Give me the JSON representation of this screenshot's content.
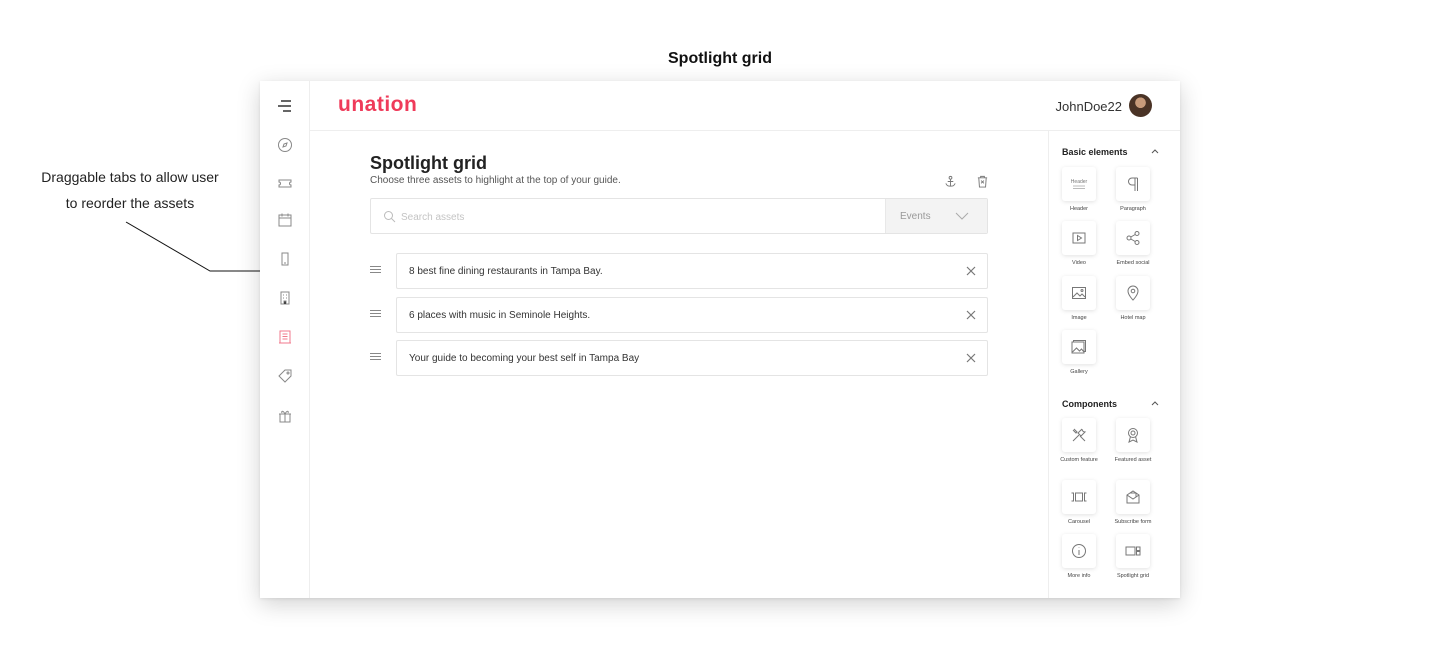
{
  "page_caption": "Spotlight grid",
  "annotation": {
    "line1": "Draggable tabs to allow user",
    "line2": "to reorder the assets"
  },
  "header": {
    "logo": "unation",
    "username": "JohnDoe22"
  },
  "nav": {
    "items": [
      "menu-icon",
      "compass-icon",
      "ticket-icon",
      "calendar-icon",
      "phone-icon",
      "building-icon",
      "guide-icon",
      "tag-icon",
      "gift-icon"
    ],
    "active": "guide-icon"
  },
  "main": {
    "title": "Spotlight grid",
    "subtitle": "Choose three assets to highlight at the top of your guide.",
    "search_placeholder": "Search assets",
    "filter_label": "Events",
    "assets": [
      "8 best fine dining restaurants in Tampa Bay.",
      "6 places with music in Seminole Heights.",
      "Your guide to becoming your best self in Tampa Bay"
    ]
  },
  "panel": {
    "basic_title": "Basic elements",
    "basic": [
      {
        "label": "Header",
        "icon": "header-icon"
      },
      {
        "label": "Paragraph",
        "icon": "paragraph-icon"
      },
      {
        "label": "Video",
        "icon": "video-icon"
      },
      {
        "label": "Embed social",
        "icon": "share-icon"
      },
      {
        "label": "Image",
        "icon": "image-icon"
      },
      {
        "label": "Hotel map",
        "icon": "map-pin-icon"
      },
      {
        "label": "Gallery",
        "icon": "gallery-icon"
      }
    ],
    "components_title": "Components",
    "components": [
      {
        "label": "Custom feature",
        "icon": "tools-icon"
      },
      {
        "label": "Featured asset",
        "icon": "award-icon"
      },
      {
        "label": "Carousel",
        "icon": "carousel-icon"
      },
      {
        "label": "Subscribe form",
        "icon": "mail-icon"
      },
      {
        "label": "More info",
        "icon": "info-icon"
      },
      {
        "label": "Spotlight grid",
        "icon": "spotlight-icon"
      }
    ]
  },
  "colors": {
    "brand": "#ef3b5a",
    "active_nav": "#f07a8c"
  }
}
